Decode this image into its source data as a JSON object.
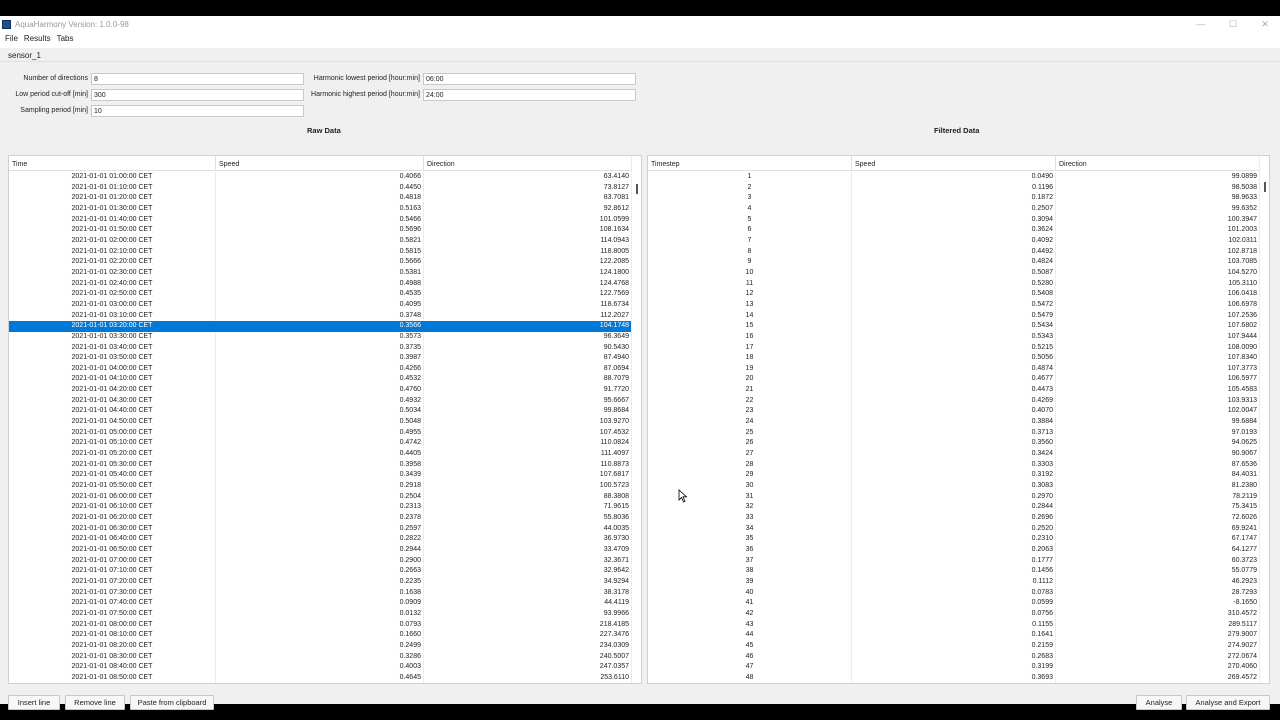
{
  "window": {
    "title": "AquaHarmony Version: 1.0.0-98",
    "controls": [
      "—",
      "☐",
      "✕"
    ]
  },
  "menu": [
    "File",
    "Results",
    "Tabs"
  ],
  "tabs": [
    {
      "label": "sensor_1"
    }
  ],
  "params": {
    "num_directions": {
      "label": "Number of directions",
      "value": "8"
    },
    "low_cutoff": {
      "label": "Low period cut-off [min]",
      "value": "300"
    },
    "sampling_period": {
      "label": "Sampling period [min]",
      "value": "10"
    },
    "harmonic_lowest": {
      "label": "Harmonic lowest period [hour:min]",
      "value": "06:00"
    },
    "harmonic_highest": {
      "label": "Harmonic highest period [hour:min]",
      "value": "24:00"
    }
  },
  "raw": {
    "title": "Raw Data",
    "columns": [
      "Time",
      "Speed",
      "Direction"
    ],
    "selected_index": 14,
    "rows": [
      [
        "2021-01-01 01:00:00 CET",
        "0.4066",
        "63.4140"
      ],
      [
        "2021-01-01 01:10:00 CET",
        "0.4450",
        "73.8127"
      ],
      [
        "2021-01-01 01:20:00 CET",
        "0.4818",
        "83.7081"
      ],
      [
        "2021-01-01 01:30:00 CET",
        "0.5163",
        "92.8612"
      ],
      [
        "2021-01-01 01:40:00 CET",
        "0.5466",
        "101.0599"
      ],
      [
        "2021-01-01 01:50:00 CET",
        "0.5696",
        "108.1634"
      ],
      [
        "2021-01-01 02:00:00 CET",
        "0.5821",
        "114.0943"
      ],
      [
        "2021-01-01 02:10:00 CET",
        "0.5815",
        "118.8005"
      ],
      [
        "2021-01-01 02:20:00 CET",
        "0.5666",
        "122.2085"
      ],
      [
        "2021-01-01 02:30:00 CET",
        "0.5381",
        "124.1800"
      ],
      [
        "2021-01-01 02:40:00 CET",
        "0.4988",
        "124.4768"
      ],
      [
        "2021-01-01 02:50:00 CET",
        "0.4535",
        "122.7569"
      ],
      [
        "2021-01-01 03:00:00 CET",
        "0.4095",
        "118.6734"
      ],
      [
        "2021-01-01 03:10:00 CET",
        "0.3748",
        "112.2027"
      ],
      [
        "2021-01-01 03:20:00 CET",
        "0.3566",
        "104.1748"
      ],
      [
        "2021-01-01 03:30:00 CET",
        "0.3573",
        "96.3649"
      ],
      [
        "2021-01-01 03:40:00 CET",
        "0.3735",
        "90.5430"
      ],
      [
        "2021-01-01 03:50:00 CET",
        "0.3987",
        "87.4940"
      ],
      [
        "2021-01-01 04:00:00 CET",
        "0.4266",
        "87.0694"
      ],
      [
        "2021-01-01 04:10:00 CET",
        "0.4532",
        "88.7079"
      ],
      [
        "2021-01-01 04:20:00 CET",
        "0.4760",
        "91.7720"
      ],
      [
        "2021-01-01 04:30:00 CET",
        "0.4932",
        "95.6667"
      ],
      [
        "2021-01-01 04:40:00 CET",
        "0.5034",
        "99.8684"
      ],
      [
        "2021-01-01 04:50:00 CET",
        "0.5048",
        "103.9270"
      ],
      [
        "2021-01-01 05:00:00 CET",
        "0.4955",
        "107.4532"
      ],
      [
        "2021-01-01 05:10:00 CET",
        "0.4742",
        "110.0824"
      ],
      [
        "2021-01-01 05:20:00 CET",
        "0.4405",
        "111.4097"
      ],
      [
        "2021-01-01 05:30:00 CET",
        "0.3958",
        "110.8873"
      ],
      [
        "2021-01-01 05:40:00 CET",
        "0.3439",
        "107.6817"
      ],
      [
        "2021-01-01 05:50:00 CET",
        "0.2918",
        "100.5723"
      ],
      [
        "2021-01-01 06:00:00 CET",
        "0.2504",
        "88.3808"
      ],
      [
        "2021-01-01 06:10:00 CET",
        "0.2313",
        "71.9615"
      ],
      [
        "2021-01-01 06:20:00 CET",
        "0.2378",
        "55.8036"
      ],
      [
        "2021-01-01 06:30:00 CET",
        "0.2597",
        "44.0035"
      ],
      [
        "2021-01-01 06:40:00 CET",
        "0.2822",
        "36.9730"
      ],
      [
        "2021-01-01 06:50:00 CET",
        "0.2944",
        "33.4709"
      ],
      [
        "2021-01-01 07:00:00 CET",
        "0.2900",
        "32.3671"
      ],
      [
        "2021-01-01 07:10:00 CET",
        "0.2663",
        "32.9642"
      ],
      [
        "2021-01-01 07:20:00 CET",
        "0.2235",
        "34.9294"
      ],
      [
        "2021-01-01 07:30:00 CET",
        "0.1638",
        "38.3178"
      ],
      [
        "2021-01-01 07:40:00 CET",
        "0.0909",
        "44.4119"
      ],
      [
        "2021-01-01 07:50:00 CET",
        "0.0132",
        "93.9966"
      ],
      [
        "2021-01-01 08:00:00 CET",
        "0.0793",
        "218.4185"
      ],
      [
        "2021-01-01 08:10:00 CET",
        "0.1660",
        "227.3476"
      ],
      [
        "2021-01-01 08:20:00 CET",
        "0.2499",
        "234.0309"
      ],
      [
        "2021-01-01 08:30:00 CET",
        "0.3286",
        "240.5007"
      ],
      [
        "2021-01-01 08:40:00 CET",
        "0.4003",
        "247.0357"
      ],
      [
        "2021-01-01 08:50:00 CET",
        "0.4645",
        "253.6110"
      ]
    ]
  },
  "filtered": {
    "title": "Filtered Data",
    "columns": [
      "Timestep",
      "Speed",
      "Direction"
    ],
    "rows": [
      [
        "1",
        "0.0490",
        "99.0899"
      ],
      [
        "2",
        "0.1196",
        "98.5038"
      ],
      [
        "3",
        "0.1872",
        "98.9633"
      ],
      [
        "4",
        "0.2507",
        "99.6352"
      ],
      [
        "5",
        "0.3094",
        "100.3947"
      ],
      [
        "6",
        "0.3624",
        "101.2003"
      ],
      [
        "7",
        "0.4092",
        "102.0311"
      ],
      [
        "8",
        "0.4492",
        "102.8718"
      ],
      [
        "9",
        "0.4824",
        "103.7085"
      ],
      [
        "10",
        "0.5087",
        "104.5270"
      ],
      [
        "11",
        "0.5280",
        "105.3110"
      ],
      [
        "12",
        "0.5408",
        "106.0418"
      ],
      [
        "13",
        "0.5472",
        "106.6978"
      ],
      [
        "14",
        "0.5479",
        "107.2536"
      ],
      [
        "15",
        "0.5434",
        "107.6802"
      ],
      [
        "16",
        "0.5343",
        "107.9444"
      ],
      [
        "17",
        "0.5215",
        "108.0090"
      ],
      [
        "18",
        "0.5056",
        "107.8340"
      ],
      [
        "19",
        "0.4874",
        "107.3773"
      ],
      [
        "20",
        "0.4677",
        "106.5977"
      ],
      [
        "21",
        "0.4473",
        "105.4583"
      ],
      [
        "22",
        "0.4269",
        "103.9313"
      ],
      [
        "23",
        "0.4070",
        "102.0047"
      ],
      [
        "24",
        "0.3884",
        "99.6884"
      ],
      [
        "25",
        "0.3713",
        "97.0193"
      ],
      [
        "26",
        "0.3560",
        "94.0625"
      ],
      [
        "27",
        "0.3424",
        "90.9067"
      ],
      [
        "28",
        "0.3303",
        "87.6536"
      ],
      [
        "29",
        "0.3192",
        "84.4031"
      ],
      [
        "30",
        "0.3083",
        "81.2380"
      ],
      [
        "31",
        "0.2970",
        "78.2119"
      ],
      [
        "32",
        "0.2844",
        "75.3415"
      ],
      [
        "33",
        "0.2696",
        "72.6026"
      ],
      [
        "34",
        "0.2520",
        "69.9241"
      ],
      [
        "35",
        "0.2310",
        "67.1747"
      ],
      [
        "36",
        "0.2063",
        "64.1277"
      ],
      [
        "37",
        "0.1777",
        "60.3723"
      ],
      [
        "38",
        "0.1456",
        "55.0779"
      ],
      [
        "39",
        "0.1112",
        "46.2923"
      ],
      [
        "40",
        "0.0783",
        "28.7293"
      ],
      [
        "41",
        "0.0599",
        "-8.1650"
      ],
      [
        "42",
        "0.0756",
        "310.4572"
      ],
      [
        "43",
        "0.1155",
        "289.5117"
      ],
      [
        "44",
        "0.1641",
        "279.9007"
      ],
      [
        "45",
        "0.2159",
        "274.9027"
      ],
      [
        "46",
        "0.2683",
        "272.0674"
      ],
      [
        "47",
        "0.3199",
        "270.4060"
      ],
      [
        "48",
        "0.3693",
        "269.4572"
      ]
    ]
  },
  "buttons": {
    "insert_line": "Insert line",
    "remove_line": "Remove line",
    "paste_clipboard": "Paste from clipboard",
    "analyse": "Analyse",
    "analyse_export": "Analyse and Export"
  },
  "colors": {
    "selection": "#0078d7",
    "panel_bg": "#f0f0f0"
  }
}
